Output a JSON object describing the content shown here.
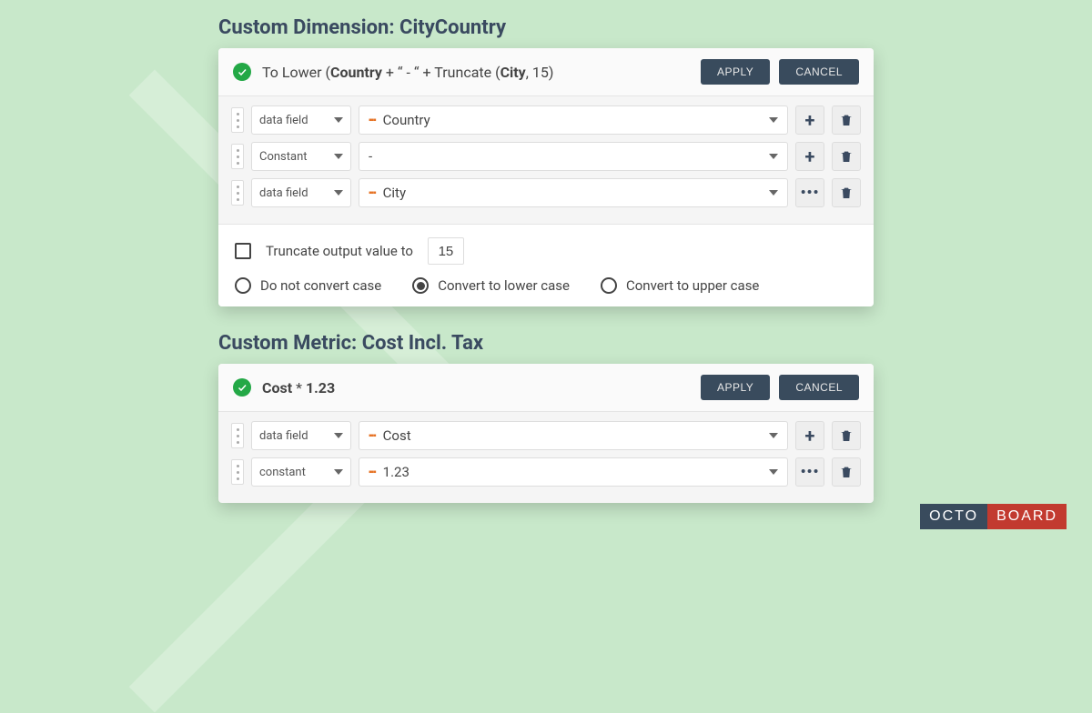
{
  "logo": {
    "left": "OCTO",
    "right": "BOARD"
  },
  "section1": {
    "title": "Custom Dimension: CityCountry",
    "formula_prefix": "To Lower (",
    "formula_b1": "Country",
    "formula_mid1": " + “ - “ + Truncate (",
    "formula_b2": "City",
    "formula_suffix": ", 15)",
    "apply": "APPLY",
    "cancel": "CANCEL",
    "rows": [
      {
        "type": "data field",
        "value": "Country",
        "has_marker": true,
        "action": "plus"
      },
      {
        "type": "Constant",
        "value": "-",
        "has_marker": false,
        "action": "plus"
      },
      {
        "type": "data field",
        "value": "City",
        "has_marker": true,
        "action": "dots"
      }
    ],
    "truncate_label": "Truncate output value to",
    "truncate_value": "15",
    "case_options": {
      "none": "Do not convert case",
      "lower": "Convert to lower case",
      "upper": "Convert to upper case",
      "selected": "lower"
    }
  },
  "section2": {
    "title": "Custom Metric: Cost Incl. Tax",
    "formula_b1": "Cost",
    "formula_mid": " * ",
    "formula_b2": "1.23",
    "apply": "APPLY",
    "cancel": "CANCEL",
    "rows": [
      {
        "type": "data field",
        "value": "Cost",
        "has_marker": true,
        "action": "plus"
      },
      {
        "type": "constant",
        "value": "1.23",
        "has_marker": true,
        "action": "dots"
      }
    ]
  }
}
